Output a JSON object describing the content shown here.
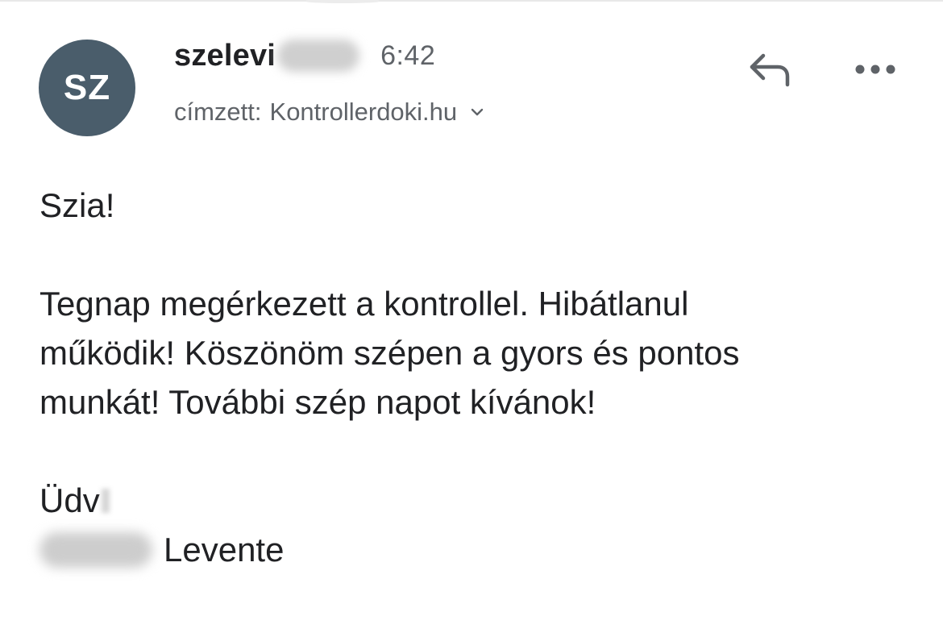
{
  "sender": {
    "avatar_initials": "SZ",
    "name_visible": "szelevi",
    "time": "6:42",
    "avatar_color": "#4a5d6b"
  },
  "recipient": {
    "label": "címzett:",
    "value": "Kontrollerdoki.hu",
    "expand_icon": "chevron-down-icon"
  },
  "actions": {
    "reply_icon": "reply-icon",
    "more_icon": "more-horizontal-icon"
  },
  "message": {
    "greeting": "Szia!",
    "line1": "Tegnap megérkezett a kontrollel. Hibátlanul",
    "line2": "működik! Köszönöm szépen a gyors és pontos",
    "line3": "munkát! További szép napot kívánok!",
    "closing": "Üdv",
    "signature_visible": "Levente"
  }
}
